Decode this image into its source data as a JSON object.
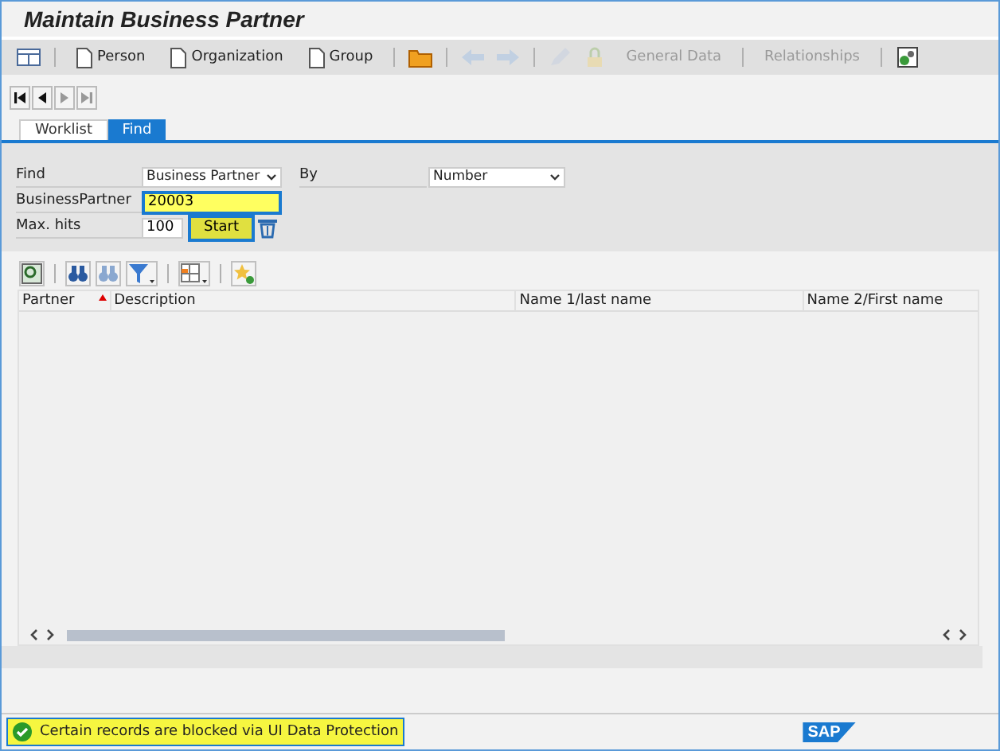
{
  "window": {
    "title": "Maintain Business Partner"
  },
  "toolbar": [
    {
      "kind": "icon",
      "disabled": false
    },
    {
      "kind": "sep"
    },
    {
      "kind": "doc_button",
      "label": "Person",
      "disabled": false
    },
    {
      "kind": "doc_button",
      "label": "Organization",
      "disabled": false
    },
    {
      "kind": "doc_button",
      "label": "Group",
      "disabled": false
    },
    {
      "kind": "sep"
    },
    {
      "kind": "icon",
      "disabled": false
    },
    {
      "kind": "sep"
    },
    {
      "kind": "icon",
      "disabled": true
    },
    {
      "kind": "icon",
      "disabled": true
    },
    {
      "kind": "sep"
    },
    {
      "kind": "icon",
      "disabled": true
    },
    {
      "kind": "icon",
      "disabled": true
    },
    {
      "kind": "button",
      "label": "General Data",
      "disabled": true
    },
    {
      "kind": "sep"
    },
    {
      "kind": "button",
      "label": "Relationships",
      "disabled": true
    },
    {
      "kind": "sep"
    },
    {
      "kind": "icon",
      "disabled": false
    }
  ],
  "nav_buttons": [
    {
      "disabled": false
    },
    {
      "disabled": false
    },
    {
      "disabled": true
    },
    {
      "disabled": true
    }
  ],
  "tabs": [
    {
      "label": "Worklist",
      "selected": false
    },
    {
      "label": "Find",
      "selected": true
    }
  ],
  "form": {
    "find_label": "Find",
    "find_value": "Business Partner",
    "by_label": "By",
    "by_value": "Number",
    "partner_label": "BusinessPartner",
    "partner_value": "20003",
    "maxhits_label": "Max. hits",
    "maxhits_value": "100",
    "start": "Start"
  },
  "table": {
    "columns": [
      {
        "label": "Partner",
        "sorted": true
      },
      {
        "label": "Description",
        "sorted": false
      },
      {
        "label": "Name 1/last name",
        "sorted": false
      },
      {
        "label": "Name 2/First name",
        "sorted": false
      }
    ]
  },
  "status_bar": {
    "message": "Certain records are blocked via UI Data Protection",
    "logo": "SAP"
  }
}
